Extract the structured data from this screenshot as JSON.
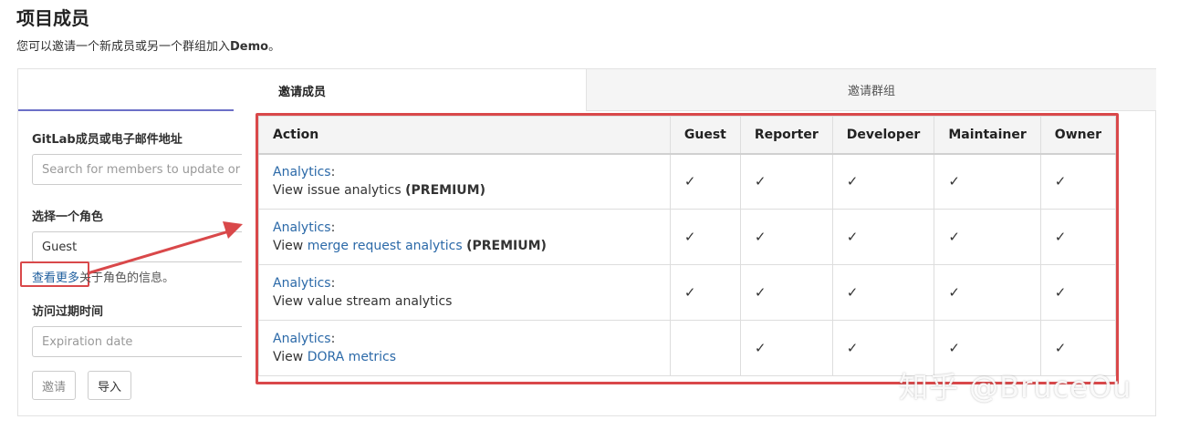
{
  "page": {
    "title": "项目成员",
    "desc_prefix": "您可以邀请一个新成员或另一个群组加入",
    "desc_project": "Demo",
    "desc_suffix": "。"
  },
  "tabs": {
    "invite_member": "邀请成员",
    "invite_group": "邀请群组"
  },
  "form": {
    "member_label": "GitLab成员或电子邮件地址",
    "member_placeholder": "Search for members to update or",
    "role_label": "选择一个角色",
    "role_value": "Guest",
    "help_link": "查看更多",
    "help_text": "关于角色的信息。",
    "expiry_label": "访问过期时间",
    "expiry_placeholder": "Expiration date",
    "invite_button": "邀请",
    "import_button": "导入"
  },
  "permissions_table": {
    "headers": [
      "Action",
      "Guest",
      "Reporter",
      "Developer",
      "Maintainer",
      "Owner"
    ],
    "check_mark": "✓",
    "rows": [
      {
        "category": "Analytics",
        "sep": ":",
        "prefix": "View ",
        "link": "",
        "plain": "issue analytics ",
        "tag": "(PREMIUM)",
        "checks": [
          true,
          true,
          true,
          true,
          true
        ]
      },
      {
        "category": "Analytics",
        "sep": ":",
        "prefix": "View ",
        "link": "merge request analytics",
        "plain": " ",
        "tag": "(PREMIUM)",
        "checks": [
          true,
          true,
          true,
          true,
          true
        ]
      },
      {
        "category": "Analytics",
        "sep": ":",
        "prefix": "View ",
        "link": "",
        "plain": "value stream analytics",
        "tag": "",
        "checks": [
          true,
          true,
          true,
          true,
          true
        ]
      },
      {
        "category": "Analytics",
        "sep": ":",
        "prefix": "View ",
        "link": "DORA metrics",
        "plain": "",
        "tag": "",
        "checks": [
          false,
          true,
          true,
          true,
          true
        ]
      }
    ]
  },
  "annotation": {
    "color": "#d9484a"
  },
  "watermark": "知乎 @BruceOu"
}
